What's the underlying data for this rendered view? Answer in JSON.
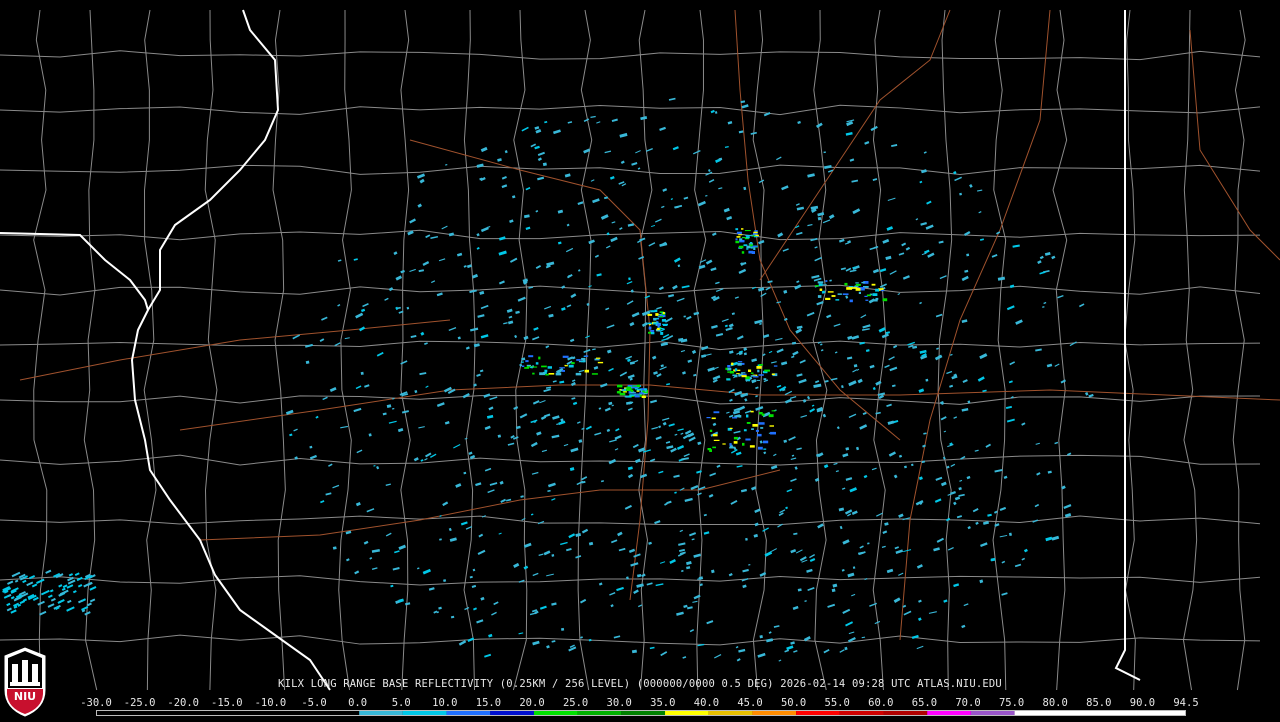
{
  "product_title": "KILX LONG RANGE BASE REFLECTIVITY (0.25KM / 256 LEVEL) (000000/0000 0.5 DEG) 2026-02-14 09:28 UTC  ATLAS.NIU.EDU",
  "logo_text": "NIU",
  "colors": {
    "background": "#000000",
    "county_line": "#8a8a8a",
    "state_line": "#ffffff",
    "highway": "#a0522d",
    "logo_red": "#c8102e"
  },
  "colorbar": {
    "ticks": [
      "-30.0",
      "-25.0",
      "-20.0",
      "-15.0",
      "-10.0",
      "-5.0",
      "0.0",
      "5.0",
      "10.0",
      "15.0",
      "20.0",
      "25.0",
      "30.0",
      "35.0",
      "40.0",
      "45.0",
      "50.0",
      "55.0",
      "60.0",
      "65.0",
      "70.0",
      "75.0",
      "80.0",
      "85.0",
      "90.0",
      "94.5"
    ],
    "stops": [
      {
        "dbz": 0,
        "color": "#38b8d8"
      },
      {
        "dbz": 5,
        "color": "#00c8e8"
      },
      {
        "dbz": 10,
        "color": "#2070ff"
      },
      {
        "dbz": 15,
        "color": "#0010d0"
      },
      {
        "dbz": 20,
        "color": "#00e000"
      },
      {
        "dbz": 25,
        "color": "#00b000"
      },
      {
        "dbz": 30,
        "color": "#008000"
      },
      {
        "dbz": 35,
        "color": "#ffff00"
      },
      {
        "dbz": 40,
        "color": "#e8c000"
      },
      {
        "dbz": 45,
        "color": "#ff8c00"
      },
      {
        "dbz": 50,
        "color": "#ff0000"
      },
      {
        "dbz": 55,
        "color": "#d00000"
      },
      {
        "dbz": 60,
        "color": "#b00000"
      },
      {
        "dbz": 65,
        "color": "#ff00ff"
      },
      {
        "dbz": 70,
        "color": "#9955c9"
      },
      {
        "dbz": 75,
        "color": "#ffffff"
      },
      {
        "dbz": 94.5,
        "color": "#ffffff"
      }
    ]
  },
  "echo_colors": [
    "#38b8d8",
    "#00c8e8",
    "#2070ff",
    "#00e000",
    "#ffff00"
  ]
}
